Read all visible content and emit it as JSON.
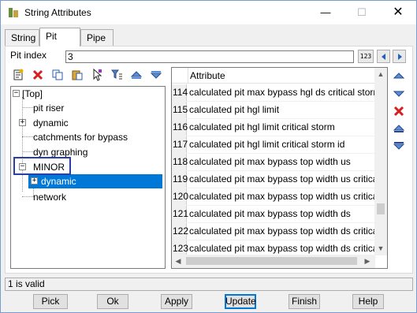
{
  "window": {
    "title": "String Attributes"
  },
  "tabs": [
    {
      "label": "String"
    },
    {
      "label": "Pit"
    },
    {
      "label": "Pipe"
    }
  ],
  "pit_index": {
    "label": "Pit index",
    "value": "3"
  },
  "tree": {
    "nodes": [
      {
        "label": "[Top]"
      },
      {
        "label": "pit riser"
      },
      {
        "label": "dynamic"
      },
      {
        "label": "catchments for bypass"
      },
      {
        "label": "dyn graphing"
      },
      {
        "label": "MINOR"
      },
      {
        "label": "dynamic"
      },
      {
        "label": "network"
      }
    ]
  },
  "grid": {
    "header": "Attribute",
    "rows": [
      {
        "num": "114",
        "value": "calculated pit max bypass hgl ds critical storm id"
      },
      {
        "num": "115",
        "value": "calculated pit hgl limit"
      },
      {
        "num": "116",
        "value": "calculated pit hgl limit critical storm"
      },
      {
        "num": "117",
        "value": "calculated pit hgl limit critical storm id"
      },
      {
        "num": "118",
        "value": "calculated pit max bypass top width us"
      },
      {
        "num": "119",
        "value": "calculated pit max bypass top width us critical storm"
      },
      {
        "num": "120",
        "value": "calculated pit max bypass top width us critical storm id"
      },
      {
        "num": "121",
        "value": "calculated pit max bypass top width ds"
      },
      {
        "num": "122",
        "value": "calculated pit max bypass top width ds critical storm"
      },
      {
        "num": "123",
        "value": "calculated pit max bypass top width ds critical storm id"
      }
    ]
  },
  "status": {
    "text": "1 is valid"
  },
  "buttons": {
    "pick": "Pick",
    "ok": "Ok",
    "apply": "Apply",
    "update": "Update",
    "finish": "Finish",
    "help": "Help"
  },
  "colors": {
    "selection": "#0078d7",
    "highlight_box": "#2b3da8",
    "delete_red": "#d42020"
  }
}
